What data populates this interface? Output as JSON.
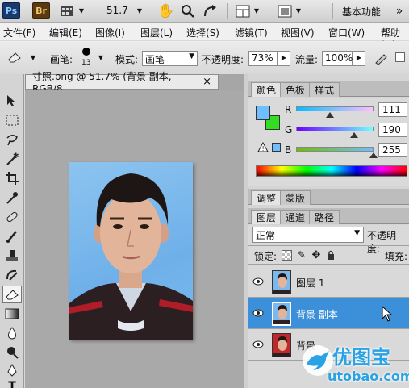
{
  "appbar": {
    "ps_logo": "Ps",
    "br_logo": "Br",
    "zoom_value": "51.7",
    "workspace_label": "基本功能"
  },
  "menu": [
    "文件(F)",
    "编辑(E)",
    "图像(I)",
    "图层(L)",
    "选择(S)",
    "滤镜(T)",
    "视图(V)",
    "窗口(W)",
    "帮助(H)"
  ],
  "options": {
    "brush_label": "画笔:",
    "brush_size": "13",
    "mode_label": "模式:",
    "mode_value": "画笔",
    "opacity_label": "不透明度:",
    "opacity_value": "73%",
    "flow_label": "流量:",
    "flow_value": "100%"
  },
  "document": {
    "tab_title": "寸照.png @ 51.7% (背景 副本, RGB/8...",
    "close_glyph": "×"
  },
  "color_panel": {
    "tabs": [
      "颜色",
      "色板",
      "样式"
    ],
    "channels": [
      {
        "label": "R",
        "value": "111",
        "fraction": 0.435
      },
      {
        "label": "G",
        "value": "190",
        "fraction": 0.745
      },
      {
        "label": "B",
        "value": "255",
        "fraction": 1.0
      }
    ],
    "foreground_color": "#6fbeff",
    "background_color": "#33dd22"
  },
  "adjust_panel": {
    "tabs": [
      "调整",
      "蒙版"
    ]
  },
  "layers_panel": {
    "tabs": [
      "图层",
      "通道",
      "路径"
    ],
    "blend_mode": "正常",
    "opacity_label": "不透明度:",
    "lock_label": "锁定:",
    "fill_label": "填充:",
    "layers": [
      {
        "name": "图层 1",
        "selected": false
      },
      {
        "name": "背景 副本",
        "selected": true
      },
      {
        "name": "背景",
        "selected": false
      }
    ]
  },
  "watermark": {
    "brand": "优图宝",
    "url": "utobao.com"
  },
  "colors": {
    "selected_layer": "#3c8fd9",
    "photo_background": "#7ab9ee"
  }
}
